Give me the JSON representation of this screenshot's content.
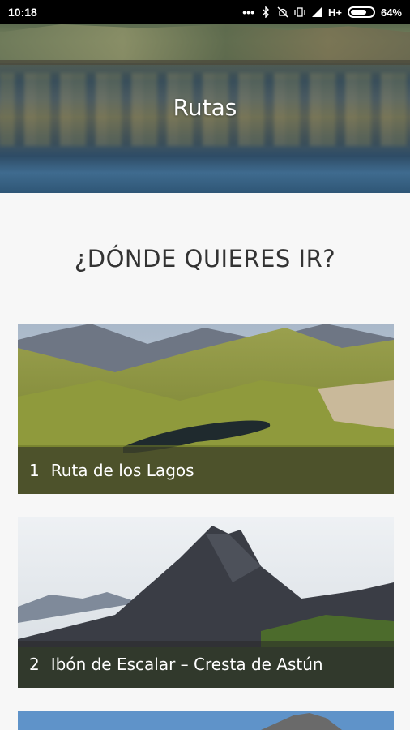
{
  "status_bar": {
    "time": "10:18",
    "network": "H+",
    "battery_percent": "64%",
    "battery_level": 0.64,
    "icons": [
      "more-dots-icon",
      "bluetooth-icon",
      "mute-icon",
      "vibrate-icon",
      "signal-icon"
    ]
  },
  "header": {
    "title": "Rutas"
  },
  "section": {
    "title": "¿DÓNDE QUIERES IR?"
  },
  "routes": [
    {
      "number": "1",
      "name": "Ruta de los Lagos"
    },
    {
      "number": "2",
      "name": "Ibón de Escalar – Cresta de Astún"
    }
  ],
  "colors": {
    "status_bar_bg": "#000000",
    "page_bg": "#f7f7f7",
    "caption_overlay": "#282828",
    "title_text": "#333333"
  }
}
